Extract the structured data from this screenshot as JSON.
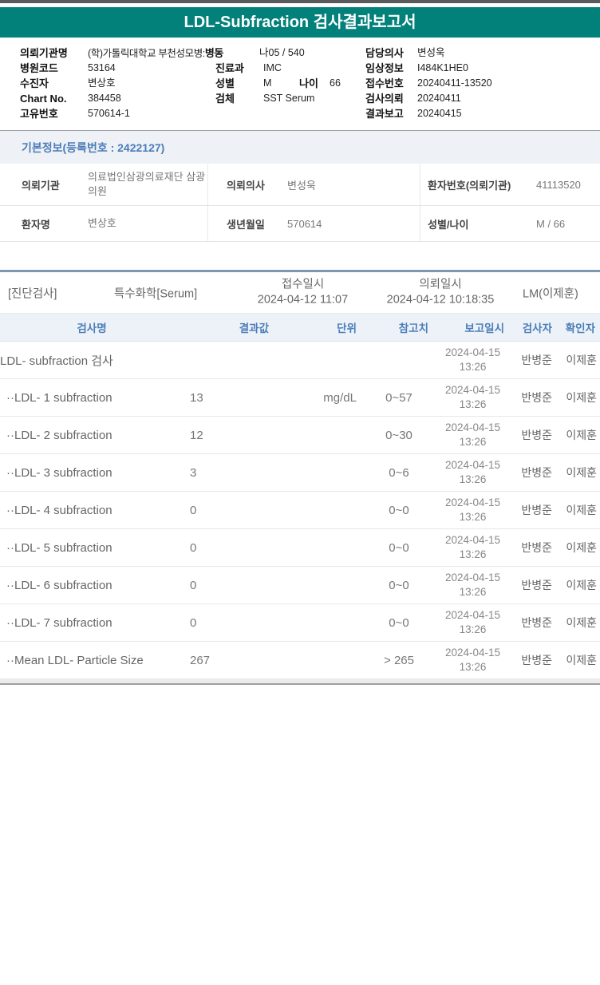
{
  "title": "LDL-Subfraction 검사결과보고서",
  "header_info": {
    "org_label": "의뢰기관명",
    "org_value": "(학)가톨릭대학교 부천성모병:",
    "ward_label": "병동",
    "ward_value": "나05 / 540",
    "hospital_code_label": "병원코드",
    "hospital_code": "53164",
    "dept_label": "진료과",
    "dept": "IMC",
    "patient_label": "수진자",
    "patient": "변상호",
    "sex_label": "성별",
    "sex": "M",
    "age_label": "나이",
    "age": "66",
    "chart_label": "Chart No.",
    "chart": "384458",
    "specimen_label": "검체",
    "specimen": "SST Serum",
    "uid_label": "고유번호",
    "uid": "570614-1",
    "doctor_label": "담당의사",
    "doctor": "변성욱",
    "clinical_label": "임상정보",
    "clinical": "I484K1HE0",
    "receipt_label": "접수번호",
    "receipt": "20240411-13520",
    "request_label": "검사의뢰",
    "request": "20240411",
    "reported_label": "결과보고",
    "reported": "20240415"
  },
  "basic_info": {
    "section_title": "기본정보(등록번호 : 2422127)",
    "rows": [
      {
        "l1": "의뢰기관",
        "v1": "의료법인삼광의료재단 삼광의원",
        "l2": "의뢰의사",
        "v2": "변성욱",
        "l3": "환자번호(의뢰기관)",
        "v3": "41113520"
      },
      {
        "l1": "환자명",
        "v1": "변상호",
        "l2": "생년월일",
        "v2": "570614",
        "l3": "성별/나이",
        "v3": "M / 66"
      }
    ]
  },
  "result_section": {
    "category": "[진단검사]",
    "panel": "특수화학[Serum]",
    "received_label": "접수일시",
    "received_at": "2024-04-12 11:07",
    "requested_label": "의뢰일시",
    "requested_at": "2024-04-12 10:18:35",
    "lab_sign": "LM(이제훈)",
    "columns": {
      "name": "검사명",
      "value": "결과값",
      "unit": "단위",
      "ref": "참고치",
      "reported": "보고일시",
      "tester": "검사자",
      "verifier": "확인자"
    },
    "rows": [
      {
        "name": "LDL- subfraction 검사",
        "value": "",
        "unit": "",
        "ref": "",
        "rep_date": "2024-04-15",
        "rep_time": "13:26",
        "tester": "반병준",
        "verifier": "이제훈"
      },
      {
        "name": "··LDL- 1 subfraction",
        "value": "13",
        "unit": "mg/dL",
        "ref": "0~57",
        "rep_date": "2024-04-15",
        "rep_time": "13:26",
        "tester": "반병준",
        "verifier": "이제훈"
      },
      {
        "name": "··LDL- 2 subfraction",
        "value": "12",
        "unit": "",
        "ref": "0~30",
        "rep_date": "2024-04-15",
        "rep_time": "13:26",
        "tester": "반병준",
        "verifier": "이제훈"
      },
      {
        "name": "··LDL- 3 subfraction",
        "value": "3",
        "unit": "",
        "ref": "0~6",
        "rep_date": "2024-04-15",
        "rep_time": "13:26",
        "tester": "반병준",
        "verifier": "이제훈"
      },
      {
        "name": "··LDL- 4 subfraction",
        "value": "0",
        "unit": "",
        "ref": "0~0",
        "rep_date": "2024-04-15",
        "rep_time": "13:26",
        "tester": "반병준",
        "verifier": "이제훈"
      },
      {
        "name": "··LDL- 5 subfraction",
        "value": "0",
        "unit": "",
        "ref": "0~0",
        "rep_date": "2024-04-15",
        "rep_time": "13:26",
        "tester": "반병준",
        "verifier": "이제훈"
      },
      {
        "name": "··LDL- 6 subfraction",
        "value": "0",
        "unit": "",
        "ref": "0~0",
        "rep_date": "2024-04-15",
        "rep_time": "13:26",
        "tester": "반병준",
        "verifier": "이제훈"
      },
      {
        "name": "··LDL- 7 subfraction",
        "value": "0",
        "unit": "",
        "ref": "0~0",
        "rep_date": "2024-04-15",
        "rep_time": "13:26",
        "tester": "반병준",
        "verifier": "이제훈"
      },
      {
        "name": "··Mean LDL- Particle Size",
        "value": "267",
        "unit": "",
        "ref": "> 265",
        "rep_date": "2024-04-15",
        "rep_time": "13:26",
        "tester": "반병준",
        "verifier": "이제훈"
      }
    ]
  },
  "colors": {
    "accent_teal": "#02807a",
    "heading_blue": "#4b7db8",
    "divider_slate": "#7d98b3"
  }
}
